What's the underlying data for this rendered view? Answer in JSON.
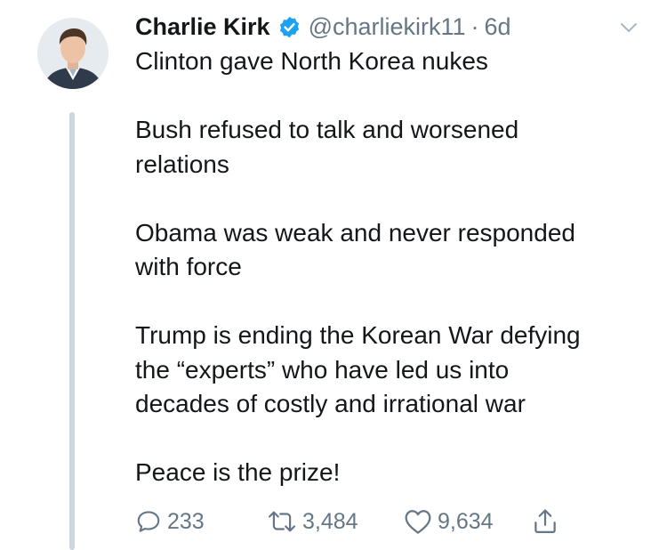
{
  "tweet": {
    "author": {
      "display_name": "Charlie Kirk",
      "handle": "@charliekirk11",
      "verified": true
    },
    "separator": "·",
    "time": "6d",
    "paragraphs": [
      [
        "Clinton gave North Korea nukes"
      ],
      [
        "Bush refused to talk and worsened",
        "relations"
      ],
      [
        "Obama was weak and never responded",
        "with force"
      ],
      [
        "Trump is ending the Korean War defying",
        "the “experts” who have led us into",
        "decades of costly and irrational war"
      ],
      [
        "Peace is the prize!"
      ]
    ],
    "actions": {
      "replies": "233",
      "retweets": "3,484",
      "likes": "9,634"
    }
  },
  "colors": {
    "text": "#14171a",
    "secondary": "#657786",
    "verified": "#1da1f2",
    "thread_line": "#ccd6dd"
  },
  "icons": [
    "verified-badge-icon",
    "chevron-down-icon",
    "reply-icon",
    "retweet-icon",
    "like-icon",
    "share-icon"
  ]
}
